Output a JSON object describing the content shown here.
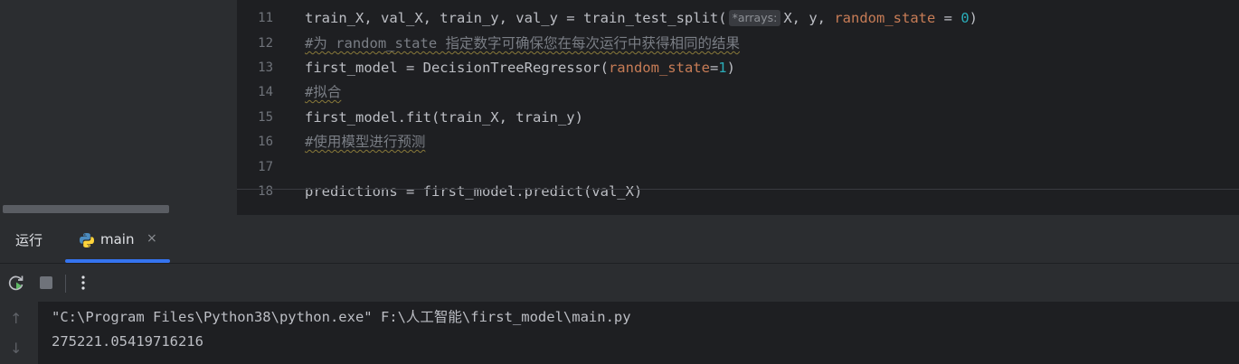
{
  "editor": {
    "line_numbers": [
      "11",
      "12",
      "13",
      "14",
      "15",
      "16",
      "17",
      "18"
    ],
    "lines": [
      {
        "pre": "train_X, val_X, train_y, val_y = train_test_split(",
        "hint": "*arrays:",
        "mid": "X, y, ",
        "param": "random_state",
        "eq": " = ",
        "num": "0",
        "post": ")"
      },
      {
        "comment": "#为 random_state 指定数字可确保您在每次运行中获得相同的结果"
      },
      {
        "pre": "first_model = DecisionTreeRegressor(",
        "param": "random_state",
        "eq": "=",
        "num": "1",
        "post": ")"
      },
      {
        "comment": "#拟合"
      },
      {
        "text": "first_model.fit(train_X, train_y)"
      },
      {
        "comment": "#使用模型进行预测"
      },
      {
        "text": ""
      },
      {
        "text": "predictions = first_model.predict(val_X)"
      }
    ]
  },
  "run_panel": {
    "title": "运行",
    "tab_label": "main",
    "tab_close": "×",
    "console_lines": [
      "\"C:\\Program Files\\Python38\\python.exe\" F:\\人工智能\\first_model\\main.py",
      "275221.05419716216"
    ]
  },
  "colors": {
    "accent": "#3574f0",
    "param": "#c77c56",
    "number": "#2aacb8",
    "rerun_green": "#5fb865"
  }
}
